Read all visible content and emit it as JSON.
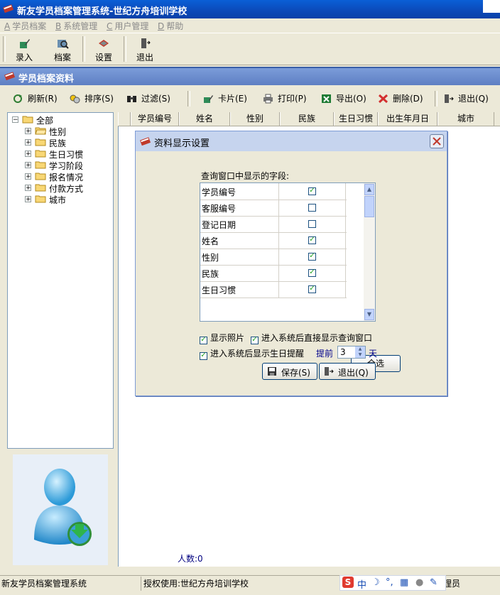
{
  "window": {
    "title": "新友学员档案管理系统-世纪方舟培训学校"
  },
  "menu": [
    {
      "key": "A",
      "label": "学员档案"
    },
    {
      "key": "B",
      "label": "系统管理"
    },
    {
      "key": "C",
      "label": "用户管理"
    },
    {
      "key": "D",
      "label": "帮助"
    }
  ],
  "toolbar": {
    "entry": "录入",
    "archive": "档案",
    "settings": "设置",
    "exit": "退出"
  },
  "child_window": {
    "title": "学员档案资料"
  },
  "toolbar2": {
    "refresh": "刷新(R)",
    "sort": "排序(S)",
    "filter": "过滤(S)",
    "card": "卡片(E)",
    "print": "打印(P)",
    "export": "导出(O)",
    "delete": "删除(D)",
    "exit": "退出(Q)"
  },
  "tree": {
    "root": "全部",
    "items": [
      "性别",
      "民族",
      "生日习惯",
      "学习阶段",
      "报名情况",
      "付款方式",
      "城市"
    ]
  },
  "grid": {
    "columns": [
      "学员编号",
      "姓名",
      "性别",
      "民族",
      "生日习惯",
      "出生年月日",
      "城市"
    ],
    "count_label": "人数:0"
  },
  "dialog": {
    "title": "资料显示设置",
    "fields_label": "查询窗口中显示的字段:",
    "fields": [
      {
        "name": "学员编号",
        "checked": true
      },
      {
        "name": "客服编号",
        "checked": false
      },
      {
        "name": "登记日期",
        "checked": false
      },
      {
        "name": "姓名",
        "checked": true
      },
      {
        "name": "性别",
        "checked": true
      },
      {
        "name": "民族",
        "checked": true
      },
      {
        "name": "生日习惯",
        "checked": true
      }
    ],
    "select_all": "全选",
    "show_photo": "显示照片",
    "show_query": "进入系统后直接显示查询窗口",
    "birthday_remind": "进入系统后显示生日提醒",
    "advance_label": "提前",
    "advance_days": "3",
    "days_unit": "天",
    "save": "保存(S)",
    "exit": "退出(Q)"
  },
  "statusbar": {
    "app": "新友学员档案管理系统",
    "license": "授权使用:世纪方舟培训学校",
    "role": "理员"
  },
  "ime": {
    "mode": "中"
  },
  "colors": {
    "title_bar": "#0B49B8",
    "child_title": "#6E8FCF",
    "dialog_title": "#C6D4EE",
    "check": "#21A121"
  }
}
